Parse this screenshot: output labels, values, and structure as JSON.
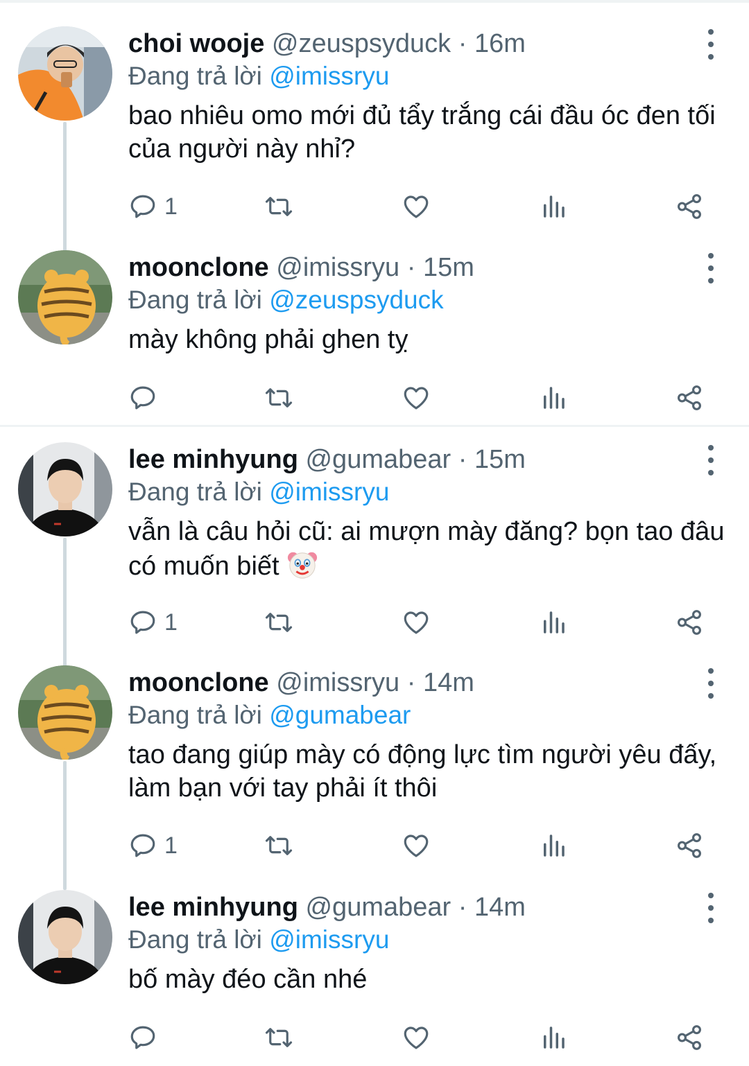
{
  "reply_prefix": "Đang trả lời",
  "threads": [
    {
      "tweets": [
        {
          "name": "choi wooje",
          "handle": "@zeuspsyduck",
          "time": "16m",
          "reply_to": "@imissryu",
          "text": "bao nhiêu omo mới đủ tẩy trắng cái đầu óc đen tối của người này nhỉ?",
          "reply_count": "1",
          "avatar": "orange-hoodie-person"
        },
        {
          "name": "moonclone",
          "handle": "@imissryu",
          "time": "15m",
          "reply_to": "@zeuspsyduck",
          "text": "mày không phải ghen tỵ",
          "reply_count": "",
          "avatar": "tiger-plush"
        }
      ]
    },
    {
      "tweets": [
        {
          "name": "lee minhyung",
          "handle": "@gumabear",
          "time": "15m",
          "reply_to": "@imissryu",
          "text": "vẫn là câu hỏi cũ: ai mượn mày đăng? bọn tao đâu có muốn biết",
          "emoji": "clown-face",
          "reply_count": "1",
          "avatar": "black-shirt-person"
        },
        {
          "name": "moonclone",
          "handle": "@imissryu",
          "time": "14m",
          "reply_to": "@gumabear",
          "text": "tao đang giúp mày có động lực tìm người yêu đấy, làm bạn với tay phải ít thôi",
          "reply_count": "1",
          "avatar": "tiger-plush"
        },
        {
          "name": "lee minhyung",
          "handle": "@gumabear",
          "time": "14m",
          "reply_to": "@imissryu",
          "text": "bố mày đéo cần nhé",
          "reply_count": "",
          "avatar": "black-shirt-person"
        }
      ]
    }
  ],
  "colors": {
    "accent": "#1d9bf0",
    "secondary_text": "#536471",
    "primary_text": "#0f1419",
    "thread_line": "#cfd9de",
    "separator": "#eff3f4"
  }
}
